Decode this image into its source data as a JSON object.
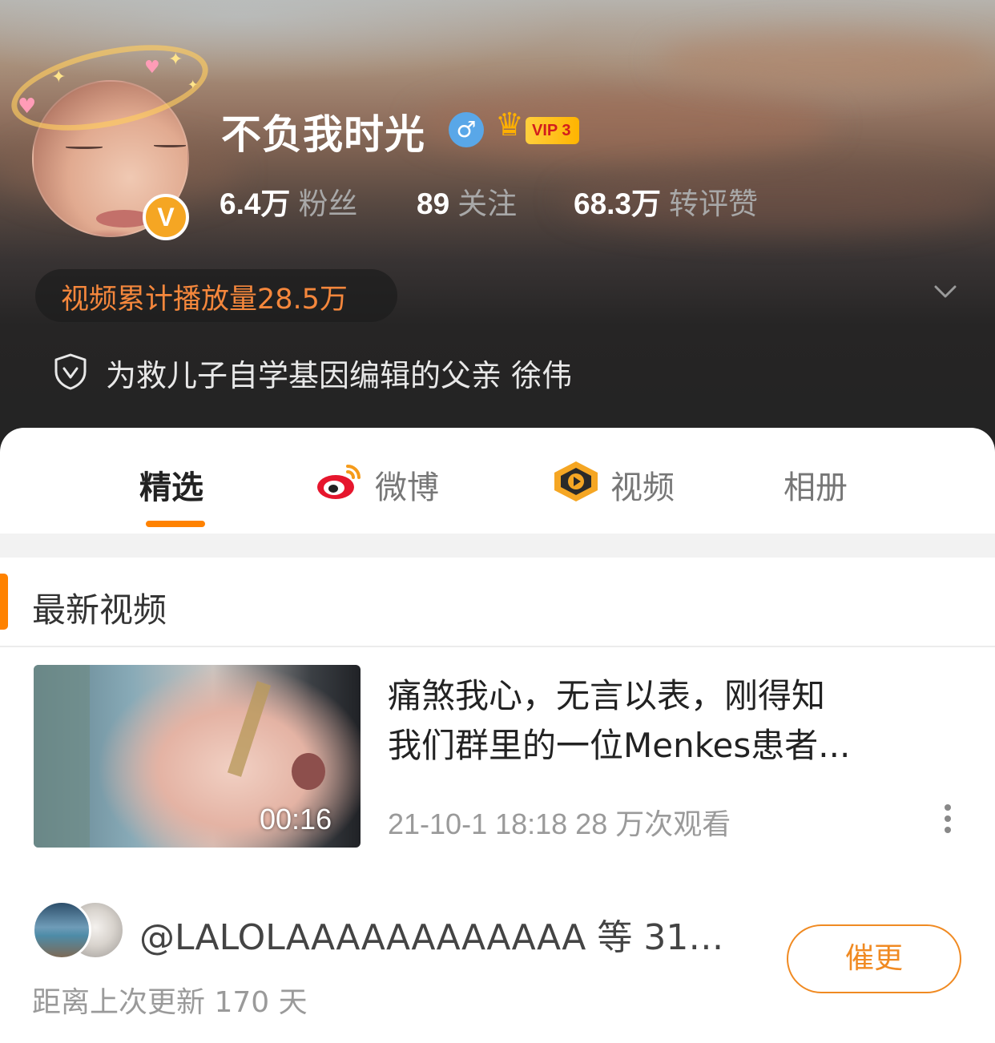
{
  "profile": {
    "username": "不负我时光",
    "gender_icon": "male-icon",
    "vip_label": "VIP 3",
    "avatar_badge": "V",
    "stats": [
      {
        "num": "6.4万",
        "label": "粉丝"
      },
      {
        "num": "89",
        "label": "关注"
      },
      {
        "num": "68.3万",
        "label": "转评赞"
      }
    ],
    "play_count": "视频累计播放量28.5万",
    "verification": "为救儿子自学基因编辑的父亲 徐伟"
  },
  "tabs": [
    {
      "label": "精选",
      "active": true
    },
    {
      "label": "微博",
      "icon": "weibo-icon"
    },
    {
      "label": "视频",
      "icon": "video-icon"
    },
    {
      "label": "相册"
    }
  ],
  "section": {
    "title": "最新视频"
  },
  "video": {
    "duration": "00:16",
    "title_line1": "痛煞我心，无言以表，刚得知",
    "title_line2": "我们群里的一位Menkes患者...",
    "meta": "21-10-1 18:18 28 万次观看"
  },
  "urge": {
    "users_text": "@LALOLAAAAAAAAAAAA 等 31…",
    "last_update": "距离上次更新 170 天",
    "button_label": "催更"
  },
  "colors": {
    "accent": "#ff8200",
    "play_count": "#f5873c",
    "gender": "#59a7e8",
    "vip": "#ffb400"
  }
}
